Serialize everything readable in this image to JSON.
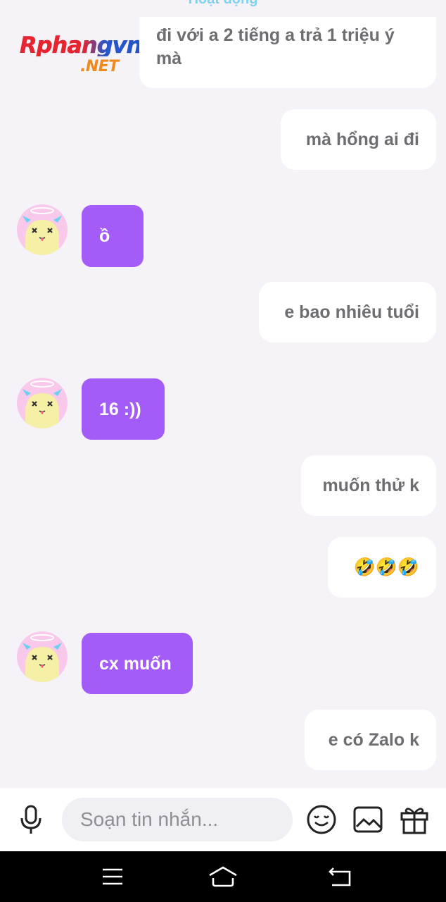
{
  "header": {
    "status_peek": "Hoạt động"
  },
  "watermark": {
    "top": "Rphangvn",
    "bottom": ".NET"
  },
  "messages": [
    {
      "side": "out",
      "text": "đi với a 2 tiếng a trả 1 triệu ý mà"
    },
    {
      "side": "out",
      "text": "mà hổng ai đi"
    },
    {
      "side": "in",
      "text": "ồ"
    },
    {
      "side": "out",
      "text": "e bao nhiêu tuổi"
    },
    {
      "side": "in",
      "text": "16 :))"
    },
    {
      "side": "out",
      "text": "muốn thử k"
    },
    {
      "side": "out",
      "text": "🤣🤣🤣"
    },
    {
      "side": "in",
      "text": "cx muốn"
    },
    {
      "side": "out",
      "text": "e có Zalo k"
    }
  ],
  "composer": {
    "placeholder": "Soạn tin nhắn...",
    "icons": [
      "microphone-icon",
      "emoji-icon",
      "image-icon",
      "gift-icon"
    ]
  },
  "navbar": {
    "icons": [
      "menu-icon",
      "home-icon",
      "back-icon"
    ]
  },
  "colors": {
    "background": "#f5f3f8",
    "incoming_bubble": "#a35cf7",
    "outgoing_bubble": "#ffffff",
    "outgoing_text": "#6e6e72",
    "avatar_bg": "#f8c9ea"
  }
}
